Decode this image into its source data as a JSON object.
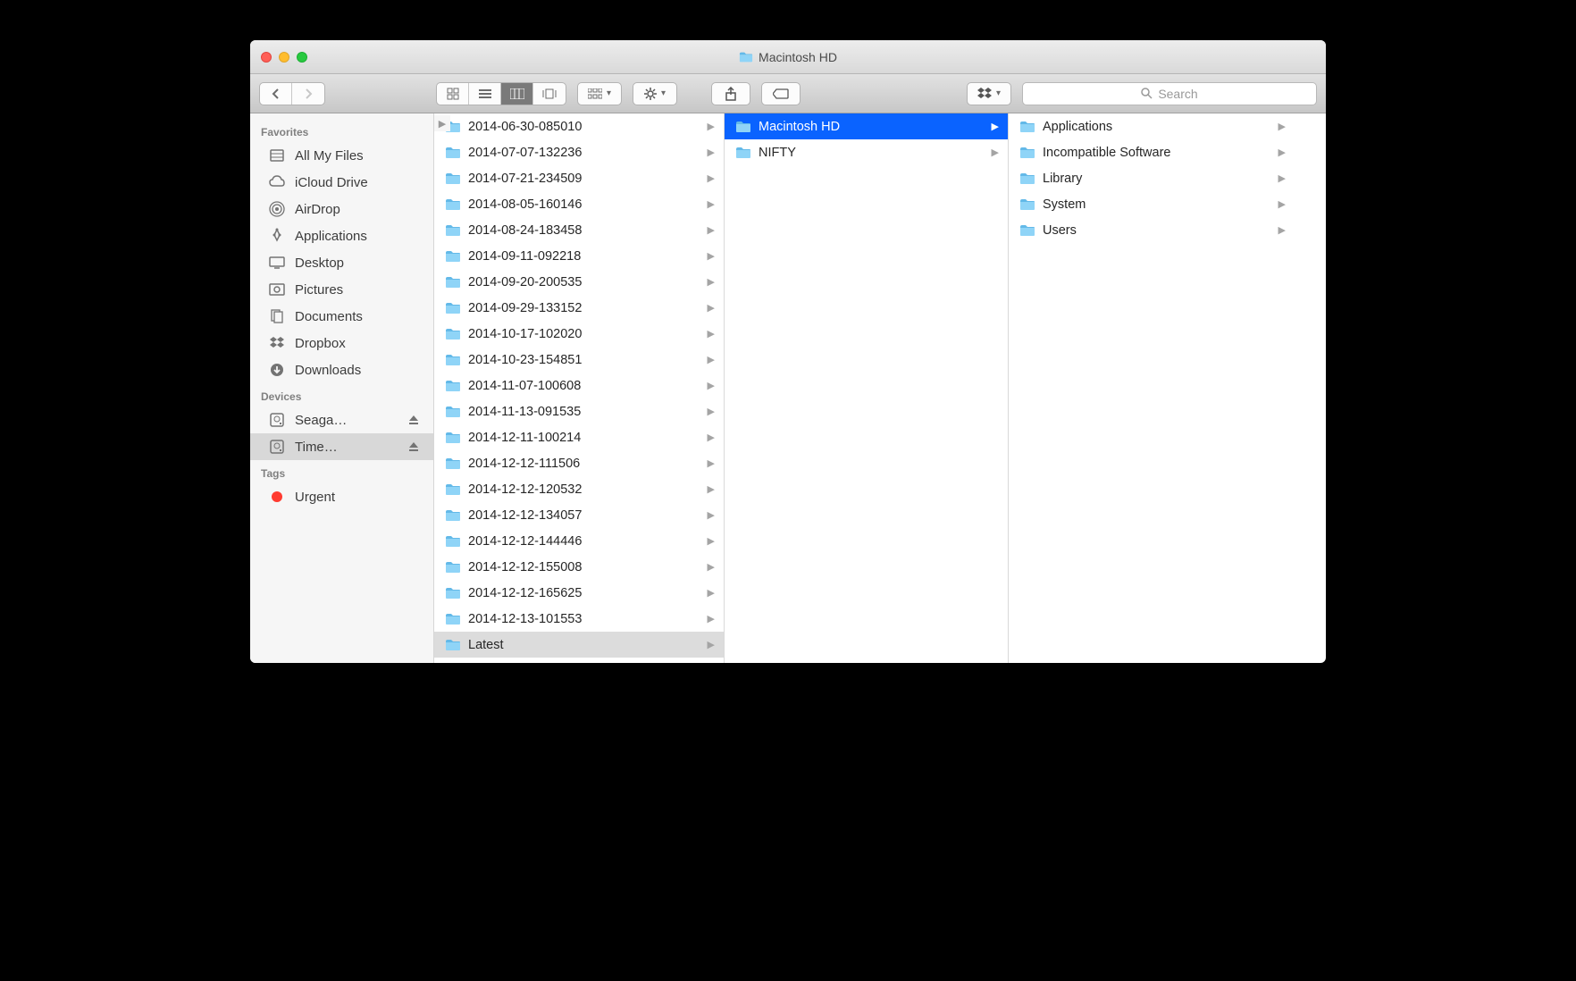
{
  "window": {
    "title": "Macintosh HD"
  },
  "toolbar": {
    "search_placeholder": "Search"
  },
  "sidebar": {
    "sections": [
      {
        "header": "Favorites",
        "items": [
          {
            "icon": "all-my-files",
            "label": "All My Files"
          },
          {
            "icon": "icloud",
            "label": "iCloud Drive"
          },
          {
            "icon": "airdrop",
            "label": "AirDrop"
          },
          {
            "icon": "applications",
            "label": "Applications"
          },
          {
            "icon": "desktop",
            "label": "Desktop"
          },
          {
            "icon": "pictures",
            "label": "Pictures"
          },
          {
            "icon": "documents",
            "label": "Documents"
          },
          {
            "icon": "dropbox",
            "label": "Dropbox"
          },
          {
            "icon": "downloads",
            "label": "Downloads"
          }
        ]
      },
      {
        "header": "Devices",
        "items": [
          {
            "icon": "disk",
            "label": "Seaga…",
            "eject": true
          },
          {
            "icon": "disk",
            "label": "Time…",
            "eject": true,
            "selected": true
          }
        ]
      },
      {
        "header": "Tags",
        "items": [
          {
            "icon": "tag-red",
            "label": "Urgent"
          }
        ]
      }
    ]
  },
  "columns": [
    {
      "items": [
        {
          "label": "2014-06-30-085010"
        },
        {
          "label": "2014-07-07-132236"
        },
        {
          "label": "2014-07-21-234509"
        },
        {
          "label": "2014-08-05-160146"
        },
        {
          "label": "2014-08-24-183458"
        },
        {
          "label": "2014-09-11-092218"
        },
        {
          "label": "2014-09-20-200535"
        },
        {
          "label": "2014-09-29-133152"
        },
        {
          "label": "2014-10-17-102020"
        },
        {
          "label": "2014-10-23-154851"
        },
        {
          "label": "2014-11-07-100608"
        },
        {
          "label": "2014-11-13-091535"
        },
        {
          "label": "2014-12-11-100214"
        },
        {
          "label": "2014-12-12-111506"
        },
        {
          "label": "2014-12-12-120532"
        },
        {
          "label": "2014-12-12-134057"
        },
        {
          "label": "2014-12-12-144446"
        },
        {
          "label": "2014-12-12-155008"
        },
        {
          "label": "2014-12-12-165625"
        },
        {
          "label": "2014-12-13-101553"
        },
        {
          "label": "Latest",
          "state": "sel-grey"
        }
      ]
    },
    {
      "items": [
        {
          "label": "Macintosh HD",
          "state": "sel-blue"
        },
        {
          "label": "NIFTY"
        }
      ]
    },
    {
      "items": [
        {
          "label": "Applications"
        },
        {
          "label": "Incompatible Software"
        },
        {
          "label": "Library"
        },
        {
          "label": "System"
        },
        {
          "label": "Users"
        }
      ]
    }
  ]
}
